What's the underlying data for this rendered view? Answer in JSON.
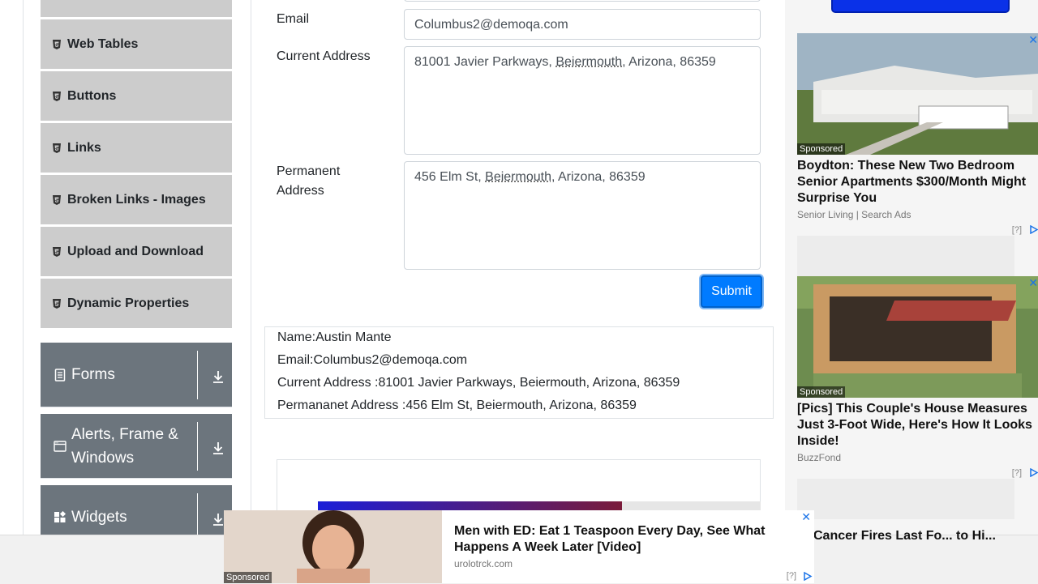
{
  "sidebar": {
    "items": [
      {
        "label": "Web Tables"
      },
      {
        "label": "Buttons"
      },
      {
        "label": "Links"
      },
      {
        "label": "Broken Links - Images"
      },
      {
        "label": "Upload and Download"
      },
      {
        "label": "Dynamic Properties"
      }
    ],
    "groups": [
      {
        "label": "Forms",
        "icon": "document-icon"
      },
      {
        "label": "Alerts, Frame & Windows",
        "icon": "window-icon"
      },
      {
        "label": "Widgets",
        "icon": "widgets-icon"
      }
    ]
  },
  "form": {
    "email_label": "Email",
    "email_value": "Columbus2@demoqa.com",
    "current_label": "Current Address",
    "current_value": {
      "pre": "81001 Javier Parkways, ",
      "city": "Beiermouth",
      "post": ", Arizona, 86359"
    },
    "permanent_label": "Permanent Address",
    "permanent_value": {
      "pre": "456 Elm St, ",
      "city": "Beiermouth",
      "post": ", Arizona, 86359"
    },
    "submit_label": "Submit"
  },
  "output": {
    "name": "Name:Austin Mante",
    "email": "Email:Columbus2@demoqa.com",
    "current": "Current Address :81001 Javier Parkways, Beiermouth, Arizona, 86359",
    "permanent": "Permananet Address :456 Elm St, Beiermouth, Arizona, 86359"
  },
  "ads": {
    "sponsored": "Sponsored",
    "help": "[?]",
    "ad1": {
      "title": "Boydton: These New Two Bedroom Senior Apartments $300/Month Might Surprise You",
      "source": "Senior Living | Search Ads"
    },
    "ad2": {
      "title": "[Pics] This Couple's House Measures Just 3-Foot Wide, Here's How It Looks Inside!",
      "source": "BuzzFond"
    },
    "bottom": {
      "title": "Men with ED: Eat 1 Teaspoon Every Day, See What Happens A Week Later [Video]",
      "source": "urolotrck.com"
    },
    "overflow_text": "Cancer Fires Last Fo... to Hi..."
  },
  "colors": {
    "accent": "#007bff",
    "sidebar_group": "#6c757d",
    "sidebar_item": "#cccccc"
  }
}
